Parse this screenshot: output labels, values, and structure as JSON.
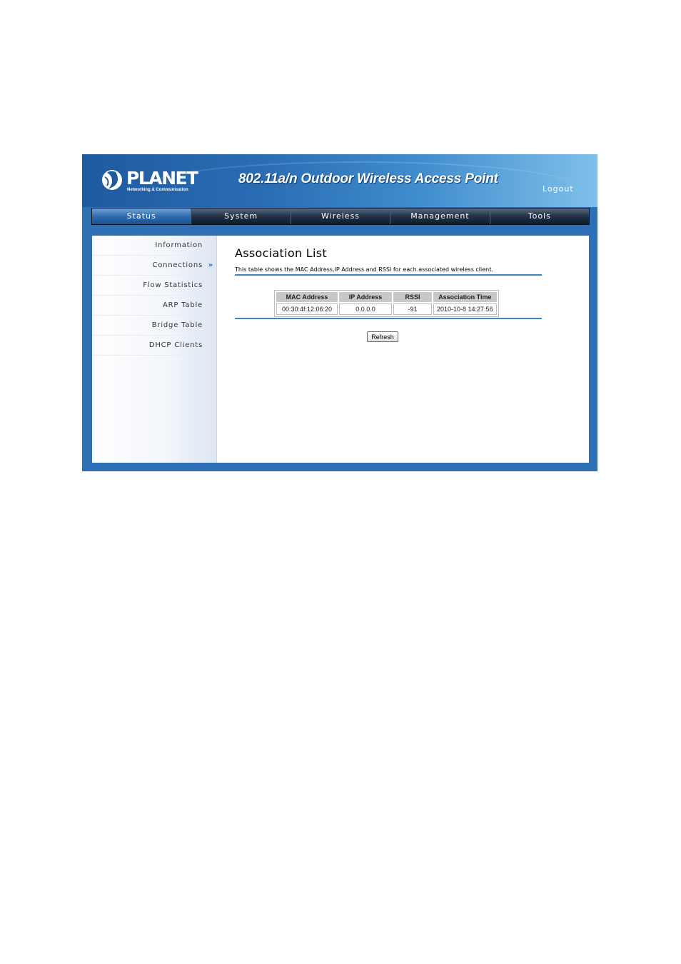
{
  "header": {
    "logo_text": "PLANET",
    "logo_subtext": "Networking & Communication",
    "product_title": "802.11a/n Outdoor Wireless Access Point",
    "logout_label": "Logout"
  },
  "nav": {
    "tabs": [
      {
        "label": "Status",
        "active": true
      },
      {
        "label": "System",
        "active": false
      },
      {
        "label": "Wireless",
        "active": false
      },
      {
        "label": "Management",
        "active": false
      },
      {
        "label": "Tools",
        "active": false
      }
    ]
  },
  "sidebar": {
    "items": [
      {
        "label": "Information",
        "selected": false
      },
      {
        "label": "Connections",
        "selected": true,
        "marker": "»"
      },
      {
        "label": "Flow Statistics",
        "selected": false
      },
      {
        "label": "ARP Table",
        "selected": false
      },
      {
        "label": "Bridge Table",
        "selected": false
      },
      {
        "label": "DHCP Clients",
        "selected": false
      }
    ]
  },
  "main": {
    "title": "Association List",
    "description": "This table shows the MAC Address,IP Address and RSSI for each associated wireless client.",
    "table": {
      "headers": [
        "MAC Address",
        "IP Address",
        "RSSI",
        "Association Time"
      ],
      "rows": [
        [
          "00:30:4f:12:06:20",
          "0.0.0.0",
          "-91",
          "2010-10-8 14:27:56"
        ]
      ]
    },
    "refresh_label": "Refresh"
  },
  "colors": {
    "frame_blue": "#2f6fb6",
    "rule_blue": "#3a86c8",
    "nav_dark": "#1a2536",
    "nav_active": "#2f6db0"
  },
  "icons": {
    "logo": "planet-globe-icon",
    "sidebar_marker": "double-chevron-right-icon"
  }
}
